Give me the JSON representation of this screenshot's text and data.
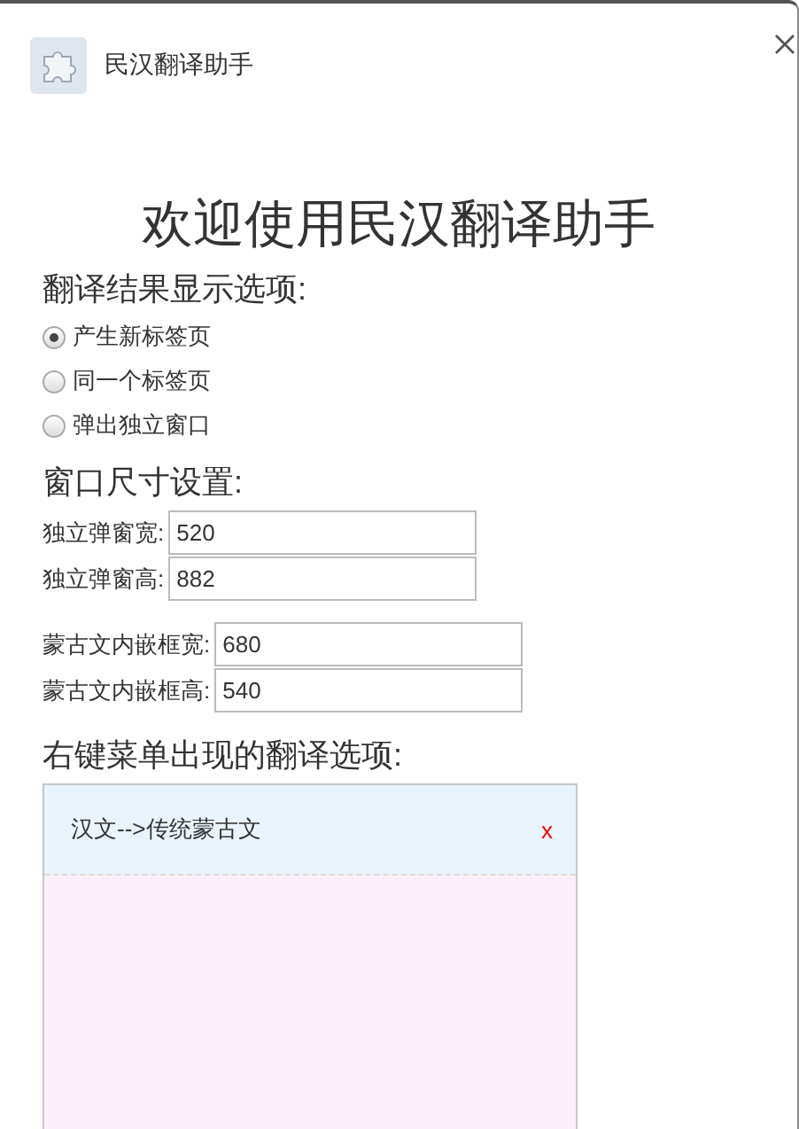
{
  "header": {
    "title": "民汉翻译助手"
  },
  "heading": "欢迎使用民汉翻译助手",
  "display_options": {
    "title": "翻译结果显示选项:",
    "options": [
      {
        "label": "产生新标签页",
        "selected": true
      },
      {
        "label": "同一个标签页",
        "selected": false
      },
      {
        "label": "弹出独立窗口",
        "selected": false
      }
    ]
  },
  "size_settings": {
    "title": "窗口尺寸设置:",
    "groups": [
      {
        "fields": [
          {
            "label": "独立弹窗宽:",
            "value": "520"
          },
          {
            "label": "独立弹窗高:",
            "value": "882"
          }
        ]
      },
      {
        "fields": [
          {
            "label": "蒙古文内嵌框宽:",
            "value": "680"
          },
          {
            "label": "蒙古文内嵌框高:",
            "value": "540"
          }
        ]
      }
    ]
  },
  "context_menu": {
    "title": "右键菜单出现的翻译选项:",
    "items": [
      {
        "label": "汉文-->传统蒙古文",
        "remove": "x"
      }
    ]
  }
}
